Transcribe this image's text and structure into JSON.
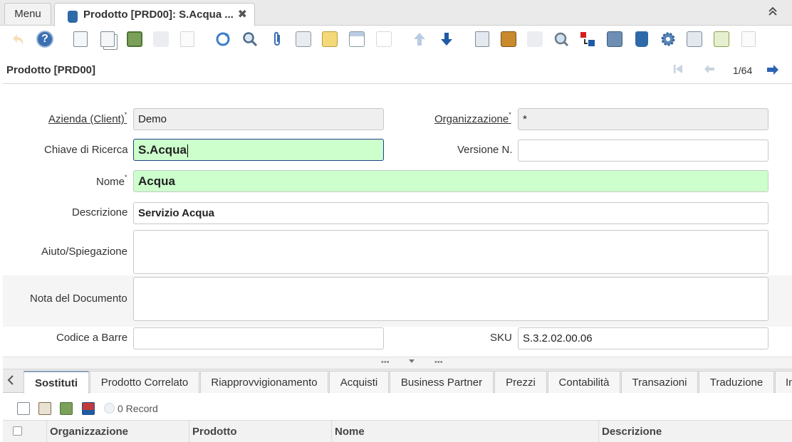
{
  "app": {
    "menu_tab": "Menu",
    "document_tab": "Prodotto [PRD00]: S.Acqua ...",
    "close_symbol": "✖",
    "collapse_symbol": "⌃"
  },
  "toolbar": {
    "icons": [
      "undo-icon",
      "help-icon",
      "new-record-icon",
      "copy-record-icon",
      "delete-icon",
      "save-icon",
      "save-new-icon",
      "refresh-icon",
      "find-icon",
      "attachment-icon",
      "chat-icon",
      "postit-icon",
      "grid-toggle-icon",
      "multi-record-icon",
      "previous-record-icon",
      "next-record-icon",
      "report-icon",
      "archive-icon",
      "print-icon",
      "zoom-across-icon",
      "request-icon",
      "workflow-icon",
      "product-info-icon",
      "window-icon",
      "settings-icon",
      "export-icon",
      "import-icon",
      "close-window-icon"
    ]
  },
  "header": {
    "title": "Prodotto [PRD00]",
    "record_position": "1/64"
  },
  "form": {
    "client_label": "Azienda (Client)",
    "client_value": "Demo",
    "org_label": "Organizzazione",
    "org_value": "*",
    "search_key_label": "Chiave di Ricerca",
    "search_key_value": "S.Acqua",
    "version_label": "Versione N.",
    "version_value": "",
    "name_label": "Nome",
    "name_value": "Acqua",
    "description_label": "Descrizione",
    "description_value": "Servizio Acqua",
    "help_label": "Aiuto/Spiegazione",
    "help_value": "",
    "doc_note_label": "Nota del Documento",
    "doc_note_value": "",
    "upc_label": "Codice a Barre",
    "upc_value": "",
    "sku_label": "SKU",
    "sku_value": "S.3.2.02.00.06",
    "required_marker": "*"
  },
  "detail_tabs": [
    "Sostituti",
    "Prodotto Correlato",
    "Riapprovvigionamento",
    "Acquisti",
    "Business Partner",
    "Prezzi",
    "Contabilità",
    "Transazioni",
    "Traduzione",
    "In"
  ],
  "grid": {
    "record_count": "0 Record",
    "columns": [
      "Organizzazione",
      "Prodotto",
      "Nome",
      "Descrizione"
    ]
  },
  "colors": {
    "accent_blue": "#2a63b4",
    "required_field": "#ccffcc",
    "readonly_field": "#efefef"
  }
}
